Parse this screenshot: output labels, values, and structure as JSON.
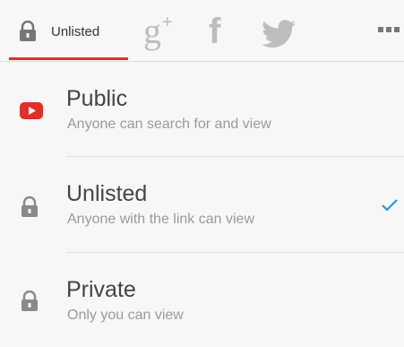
{
  "tabs": {
    "active_label": "Unlisted",
    "share_icons": [
      "google-plus-icon",
      "facebook-icon",
      "twitter-icon",
      "more-icon"
    ],
    "google_plus_glyph": "g",
    "google_plus_sup": "+",
    "facebook_glyph": "f"
  },
  "options": [
    {
      "title": "Public",
      "subtitle": "Anyone can search for and view",
      "icon": "youtube-icon",
      "selected": false
    },
    {
      "title": "Unlisted",
      "subtitle": "Anyone with the link can view",
      "icon": "lock-icon",
      "selected": true
    },
    {
      "title": "Private",
      "subtitle": "Only you can view",
      "icon": "lock-icon",
      "selected": false
    }
  ],
  "colors": {
    "accent": "#e52d27",
    "check": "#2196f3",
    "icon_gray": "#bdbdbd"
  }
}
